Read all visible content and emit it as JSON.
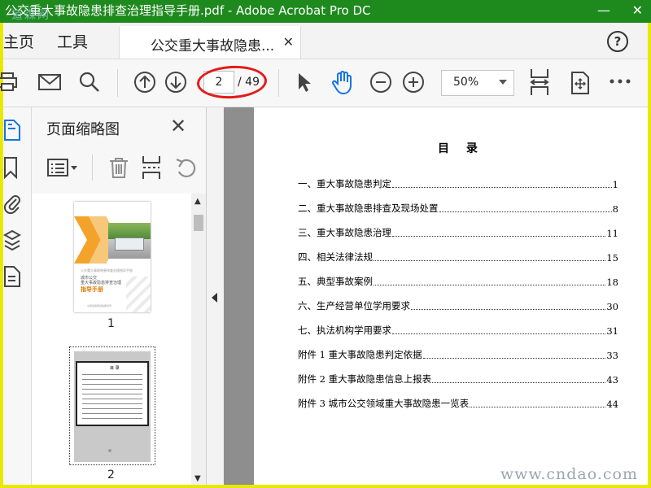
{
  "window": {
    "title": "公交重大事故隐患排查治理指导手册.pdf - Adobe Acrobat Pro DC",
    "watermark_top": "道森网",
    "watermark_bottom": "www.cndao.com"
  },
  "tabs": {
    "home": "主页",
    "tools": "工具",
    "document": "公交重大事故隐患..."
  },
  "toolbar": {
    "page_current": "2",
    "page_total": "/ 49",
    "zoom": "50%",
    "icons": [
      "print-icon",
      "email-icon",
      "search-icon",
      "prev-page-icon",
      "next-page-icon",
      "select-cursor-icon",
      "hand-tool-icon",
      "zoom-out-icon",
      "zoom-in-icon",
      "fit-page-icon",
      "full-screen-icon",
      "more-icon"
    ],
    "accent": "#1473e6",
    "highlight_ring": "#e31a1a"
  },
  "panel": {
    "title": "页面缩略图",
    "thumbnails": [
      {
        "label": "1",
        "sub": "公交重大事故隐患排查治理指导手册",
        "city": "城市公交",
        "name": "重大事故隐患排查治理",
        "guide": "指导手册",
        "footer": "交通运输部运输服务司"
      },
      {
        "label": "2",
        "heading": "目 录"
      }
    ]
  },
  "document": {
    "toc_title": "目 录",
    "toc": [
      {
        "title": "一、重大事故隐患判定",
        "page": "1"
      },
      {
        "title": "二、重大事故隐患排查及现场处置",
        "page": "8"
      },
      {
        "title": "三、重大事故隐患治理",
        "page": "11"
      },
      {
        "title": "四、相关法律法规",
        "page": "15"
      },
      {
        "title": "五、典型事故案例",
        "page": "18"
      },
      {
        "title": "六、生产经营单位学用要求",
        "page": "30"
      },
      {
        "title": "七、执法机构学用要求",
        "page": "31"
      },
      {
        "title": "附件 1  重大事故隐患判定依据",
        "page": "33"
      },
      {
        "title": "附件 2  重大事故隐患信息上报表",
        "page": "43"
      },
      {
        "title": "附件 3  城市公交领域重大事故隐患一览表",
        "page": "44"
      }
    ]
  },
  "colors": {
    "title_bar": "#1e8a1e",
    "frame_border": "#e8e800",
    "doc_background": "#8e8e8e"
  }
}
